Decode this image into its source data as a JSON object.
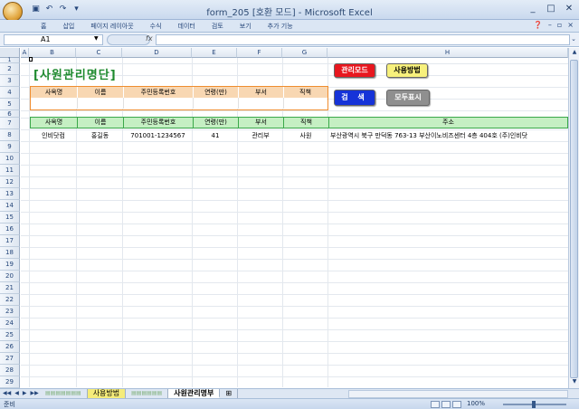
{
  "window": {
    "title": "form_205  [호환 모드] - Microsoft Excel",
    "controls": [
      "_",
      "□",
      "✕"
    ]
  },
  "qat_icons": [
    "save-icon",
    "undo-icon",
    "redo-icon",
    "customize-icon"
  ],
  "ribbon": {
    "tabs": [
      "홈",
      "삽입",
      "페이지 레이아웃",
      "수식",
      "데이터",
      "검토",
      "보기",
      "추가 기능"
    ],
    "right_icons": [
      "help-icon",
      "minimize-ribbon-icon",
      "restore-icon",
      "close-icon"
    ]
  },
  "formula_bar": {
    "name_box": "A1",
    "fx": "fx",
    "formula": ""
  },
  "columns": [
    "A",
    "B",
    "C",
    "D",
    "E",
    "F",
    "G",
    "H"
  ],
  "rows": [
    "1",
    "2",
    "3",
    "4",
    "5",
    "6",
    "7",
    "8",
    "9",
    "10",
    "11",
    "12",
    "13",
    "14",
    "15",
    "16",
    "17",
    "18",
    "19",
    "20",
    "21",
    "22",
    "23",
    "24",
    "25",
    "26",
    "27",
    "28",
    "29"
  ],
  "sheet": {
    "title": "[사원관리명단]",
    "buttons": {
      "admin_mode": "관리모드",
      "usage": "사용방법",
      "search": "검 색",
      "show_all": "모두표시"
    },
    "search_headers": [
      "사옥명",
      "이름",
      "주민등록번호",
      "연령(만)",
      "부서",
      "직책"
    ],
    "list_headers": [
      "사옥명",
      "이름",
      "주민등록번호",
      "연령(만)",
      "부서",
      "직책",
      "주소"
    ],
    "records": [
      [
        "인비닷컴",
        "홍길동",
        "701001-1234567",
        "41",
        "관리부",
        "사원",
        "부산광역시 북구 만덕동 763-13 부산이노비즈센터 4층 404호 (주)인비닷"
      ]
    ]
  },
  "sheet_tabs": [
    {
      "label": "사용방법",
      "style": "usage"
    },
    {
      "label": "사원관리명부",
      "style": "active"
    }
  ],
  "status": {
    "ready": "준비",
    "zoom": "100%"
  },
  "colors": {
    "title_green": "#1e8a2e",
    "admin_red": "#e8171f",
    "usage_yellow": "#f7f07c",
    "search_blue": "#1633d8",
    "showall_gray": "#8f8f8f",
    "search_border_orange": "#ef8d2f",
    "list_header_green": "#c5efc3"
  }
}
